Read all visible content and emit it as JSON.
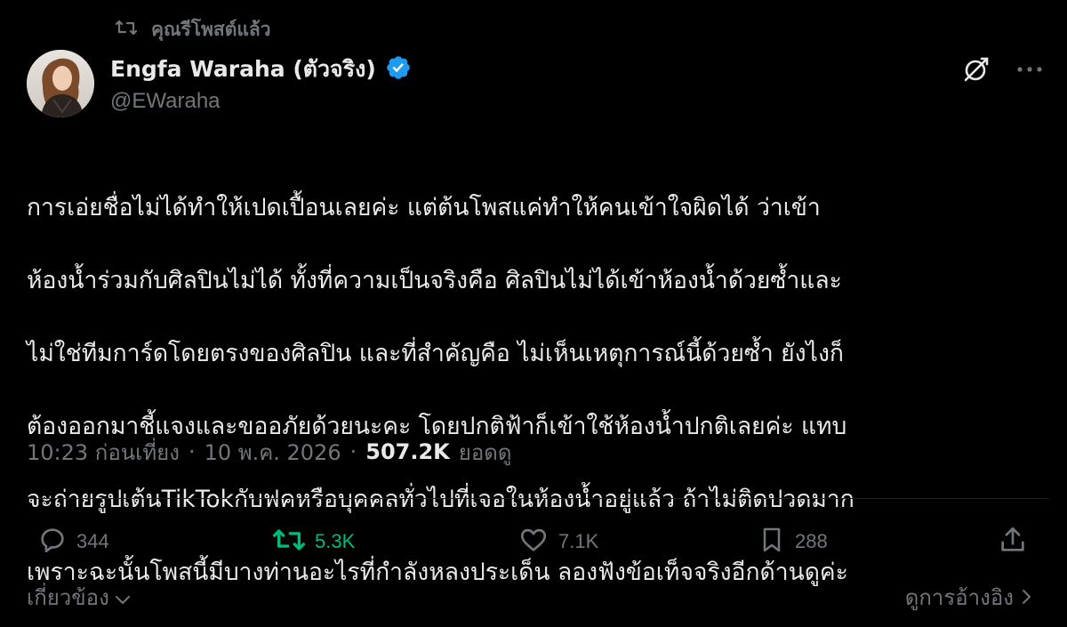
{
  "repost": {
    "label": "คุณรีโพสต์แล้ว",
    "icon": "repost-icon"
  },
  "author": {
    "name": "Engfa Waraha (ตัวจริง)",
    "handle": "@EWaraha",
    "verified": true,
    "verified_color": "#1d9bf0",
    "avatar_icon": "avatar-photo"
  },
  "header_actions": {
    "grok_icon": "grok-icon",
    "more_icon": "more-icon"
  },
  "tweet": {
    "lines": [
      "การเอ่ยชื่อไม่ได้ทำให้เปดเปื้อนเลยค่ะ แต่ต้นโพสแค่ทำให้คนเข้าใจผิดได้ ว่าเข้า",
      "ห้องน้ำร่วมกับศิลปินไม่ได้ ทั้งที่ความเป็นจริงคือ ศิลปินไม่ได้เข้าห้องน้ำด้วยซ้ำและ",
      "ไม่ใช่ทีมการ์ดโดยตรงของศิลปิน และที่สำคัญคือ ไม่เห็นเหตุการณ์นี้ด้วยซ้ำ ยังไงก็",
      "ต้องออกมาชี้แจงและขออภัยด้วยนะคะ โดยปกติฟ้าก็เข้าใช้ห้องน้ำปกติเลยค่ะ แทบ",
      "จะถ่ายรูปเต้นTikTokกับฟคหรือบุคคลทั่วไปที่เจอในห้องน้ำอยู่แล้ว ถ้าไม่ติดปวดมาก",
      "เพราะฉะนั้นโพสนี้มีบางท่านอะไรที่กำลังหลงประเด็น ลองฟังข้อเท็จจริงอีกด้านดูค่ะ"
    ]
  },
  "meta": {
    "time": "10:23 ก่อนเที่ยง",
    "separator": "·",
    "date": "10 พ.ค. 2026",
    "views_count": "507.2K",
    "views_label": "ยอดดู"
  },
  "actions": {
    "reply": {
      "icon": "reply-icon",
      "count": "344"
    },
    "repost": {
      "icon": "repost-icon",
      "count": "5.3K",
      "color": "#00ba7c"
    },
    "like": {
      "icon": "heart-icon",
      "count": "7.1K"
    },
    "bookmark": {
      "icon": "bookmark-icon",
      "count": "288"
    },
    "share": {
      "icon": "share-icon"
    }
  },
  "footer": {
    "related_label": "เกี่ยวข้อง",
    "quotes_label": "ดูการอ้างอิง"
  },
  "colors": {
    "background": "#000000",
    "text_primary": "#e7e9ea",
    "text_secondary": "#71767b",
    "accent": "#1d9bf0",
    "repost_active": "#00ba7c"
  }
}
